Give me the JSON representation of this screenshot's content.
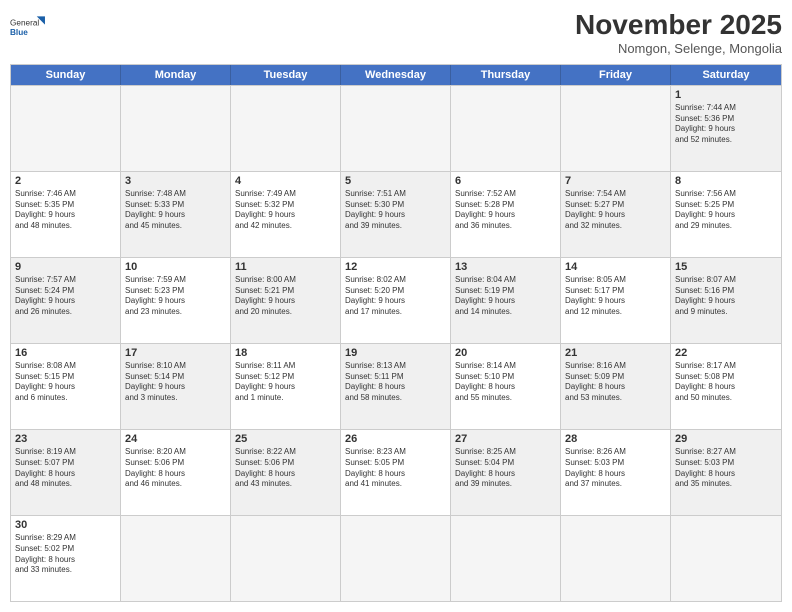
{
  "logo": {
    "text_general": "General",
    "text_blue": "Blue"
  },
  "title": "November 2025",
  "subtitle": "Nomgon, Selenge, Mongolia",
  "header_days": [
    "Sunday",
    "Monday",
    "Tuesday",
    "Wednesday",
    "Thursday",
    "Friday",
    "Saturday"
  ],
  "rows": [
    [
      {
        "day": "",
        "info": "",
        "empty": true
      },
      {
        "day": "",
        "info": "",
        "empty": true
      },
      {
        "day": "",
        "info": "",
        "empty": true
      },
      {
        "day": "",
        "info": "",
        "empty": true
      },
      {
        "day": "",
        "info": "",
        "empty": true
      },
      {
        "day": "",
        "info": "",
        "empty": true
      },
      {
        "day": "1",
        "info": "Sunrise: 7:44 AM\nSunset: 5:36 PM\nDaylight: 9 hours\nand 52 minutes.",
        "shaded": true
      }
    ],
    [
      {
        "day": "2",
        "info": "Sunrise: 7:46 AM\nSunset: 5:35 PM\nDaylight: 9 hours\nand 48 minutes."
      },
      {
        "day": "3",
        "info": "Sunrise: 7:48 AM\nSunset: 5:33 PM\nDaylight: 9 hours\nand 45 minutes.",
        "shaded": true
      },
      {
        "day": "4",
        "info": "Sunrise: 7:49 AM\nSunset: 5:32 PM\nDaylight: 9 hours\nand 42 minutes."
      },
      {
        "day": "5",
        "info": "Sunrise: 7:51 AM\nSunset: 5:30 PM\nDaylight: 9 hours\nand 39 minutes.",
        "shaded": true
      },
      {
        "day": "6",
        "info": "Sunrise: 7:52 AM\nSunset: 5:28 PM\nDaylight: 9 hours\nand 36 minutes."
      },
      {
        "day": "7",
        "info": "Sunrise: 7:54 AM\nSunset: 5:27 PM\nDaylight: 9 hours\nand 32 minutes.",
        "shaded": true
      },
      {
        "day": "8",
        "info": "Sunrise: 7:56 AM\nSunset: 5:25 PM\nDaylight: 9 hours\nand 29 minutes."
      }
    ],
    [
      {
        "day": "9",
        "info": "Sunrise: 7:57 AM\nSunset: 5:24 PM\nDaylight: 9 hours\nand 26 minutes.",
        "shaded": true
      },
      {
        "day": "10",
        "info": "Sunrise: 7:59 AM\nSunset: 5:23 PM\nDaylight: 9 hours\nand 23 minutes."
      },
      {
        "day": "11",
        "info": "Sunrise: 8:00 AM\nSunset: 5:21 PM\nDaylight: 9 hours\nand 20 minutes.",
        "shaded": true
      },
      {
        "day": "12",
        "info": "Sunrise: 8:02 AM\nSunset: 5:20 PM\nDaylight: 9 hours\nand 17 minutes."
      },
      {
        "day": "13",
        "info": "Sunrise: 8:04 AM\nSunset: 5:19 PM\nDaylight: 9 hours\nand 14 minutes.",
        "shaded": true
      },
      {
        "day": "14",
        "info": "Sunrise: 8:05 AM\nSunset: 5:17 PM\nDaylight: 9 hours\nand 12 minutes."
      },
      {
        "day": "15",
        "info": "Sunrise: 8:07 AM\nSunset: 5:16 PM\nDaylight: 9 hours\nand 9 minutes.",
        "shaded": true
      }
    ],
    [
      {
        "day": "16",
        "info": "Sunrise: 8:08 AM\nSunset: 5:15 PM\nDaylight: 9 hours\nand 6 minutes."
      },
      {
        "day": "17",
        "info": "Sunrise: 8:10 AM\nSunset: 5:14 PM\nDaylight: 9 hours\nand 3 minutes.",
        "shaded": true
      },
      {
        "day": "18",
        "info": "Sunrise: 8:11 AM\nSunset: 5:12 PM\nDaylight: 9 hours\nand 1 minute."
      },
      {
        "day": "19",
        "info": "Sunrise: 8:13 AM\nSunset: 5:11 PM\nDaylight: 8 hours\nand 58 minutes.",
        "shaded": true
      },
      {
        "day": "20",
        "info": "Sunrise: 8:14 AM\nSunset: 5:10 PM\nDaylight: 8 hours\nand 55 minutes."
      },
      {
        "day": "21",
        "info": "Sunrise: 8:16 AM\nSunset: 5:09 PM\nDaylight: 8 hours\nand 53 minutes.",
        "shaded": true
      },
      {
        "day": "22",
        "info": "Sunrise: 8:17 AM\nSunset: 5:08 PM\nDaylight: 8 hours\nand 50 minutes."
      }
    ],
    [
      {
        "day": "23",
        "info": "Sunrise: 8:19 AM\nSunset: 5:07 PM\nDaylight: 8 hours\nand 48 minutes.",
        "shaded": true
      },
      {
        "day": "24",
        "info": "Sunrise: 8:20 AM\nSunset: 5:06 PM\nDaylight: 8 hours\nand 46 minutes."
      },
      {
        "day": "25",
        "info": "Sunrise: 8:22 AM\nSunset: 5:06 PM\nDaylight: 8 hours\nand 43 minutes.",
        "shaded": true
      },
      {
        "day": "26",
        "info": "Sunrise: 8:23 AM\nSunset: 5:05 PM\nDaylight: 8 hours\nand 41 minutes."
      },
      {
        "day": "27",
        "info": "Sunrise: 8:25 AM\nSunset: 5:04 PM\nDaylight: 8 hours\nand 39 minutes.",
        "shaded": true
      },
      {
        "day": "28",
        "info": "Sunrise: 8:26 AM\nSunset: 5:03 PM\nDaylight: 8 hours\nand 37 minutes."
      },
      {
        "day": "29",
        "info": "Sunrise: 8:27 AM\nSunset: 5:03 PM\nDaylight: 8 hours\nand 35 minutes.",
        "shaded": true
      }
    ],
    [
      {
        "day": "30",
        "info": "Sunrise: 8:29 AM\nSunset: 5:02 PM\nDaylight: 8 hours\nand 33 minutes."
      },
      {
        "day": "",
        "info": "",
        "empty": true
      },
      {
        "day": "",
        "info": "",
        "empty": true
      },
      {
        "day": "",
        "info": "",
        "empty": true
      },
      {
        "day": "",
        "info": "",
        "empty": true
      },
      {
        "day": "",
        "info": "",
        "empty": true
      },
      {
        "day": "",
        "info": "",
        "empty": true
      }
    ]
  ]
}
